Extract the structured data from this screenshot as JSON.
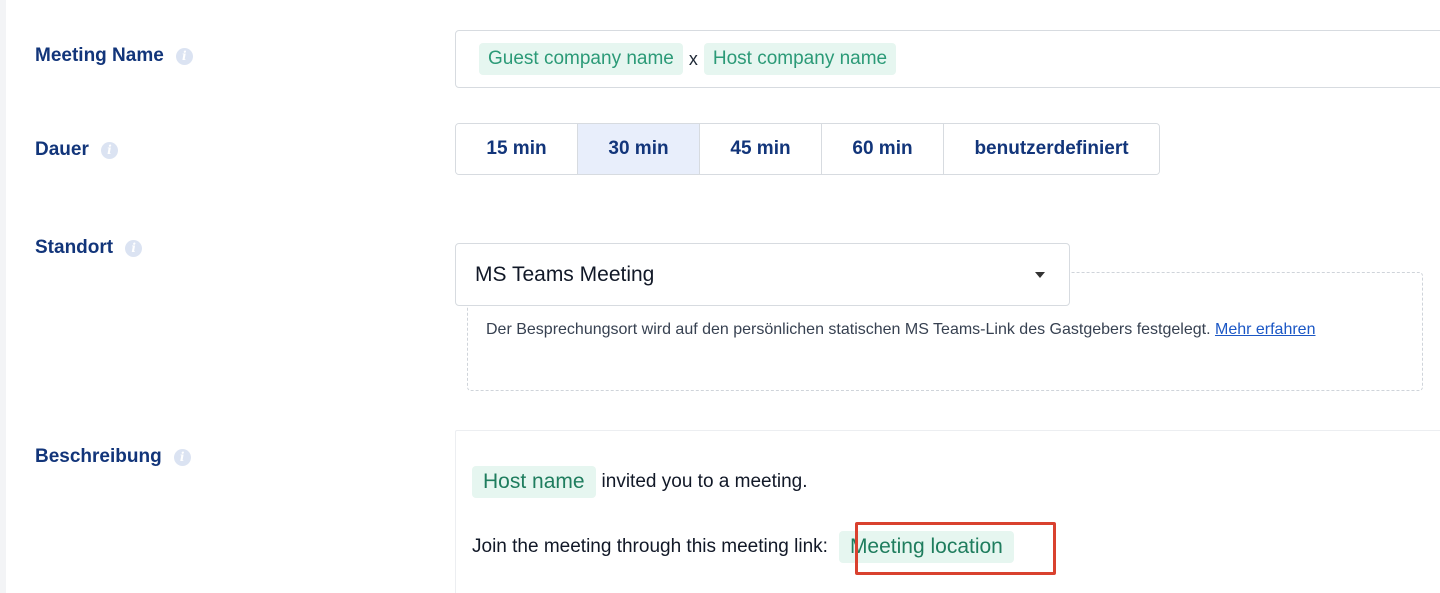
{
  "meeting_name": {
    "label": "Meeting Name",
    "tokens": [
      "Guest company name",
      "Host company name"
    ],
    "separator": "x"
  },
  "duration": {
    "label": "Dauer",
    "options": [
      "15 min",
      "30 min",
      "45 min",
      "60 min",
      "benutzerdefiniert"
    ],
    "selected": "30 min"
  },
  "location": {
    "label": "Standort",
    "selected": "MS Teams Meeting",
    "info_text": "Der Besprechungsort wird auf den persönlichen statischen MS Teams-Link des Gastgebers festgelegt.",
    "info_link": "Mehr erfahren"
  },
  "description": {
    "label": "Beschreibung",
    "line1_chip": "Host name",
    "line1_text": "invited you to a meeting.",
    "line2_text": "Join the meeting through this meeting link:",
    "line2_chip": "Meeting location"
  },
  "colors": {
    "label": "#12357a",
    "chip_bg": "#e6f6f0",
    "chip_text": "#2b9a77",
    "selected_bg": "#e8eefb",
    "highlight": "#d9412f",
    "link": "#1b57c5"
  }
}
